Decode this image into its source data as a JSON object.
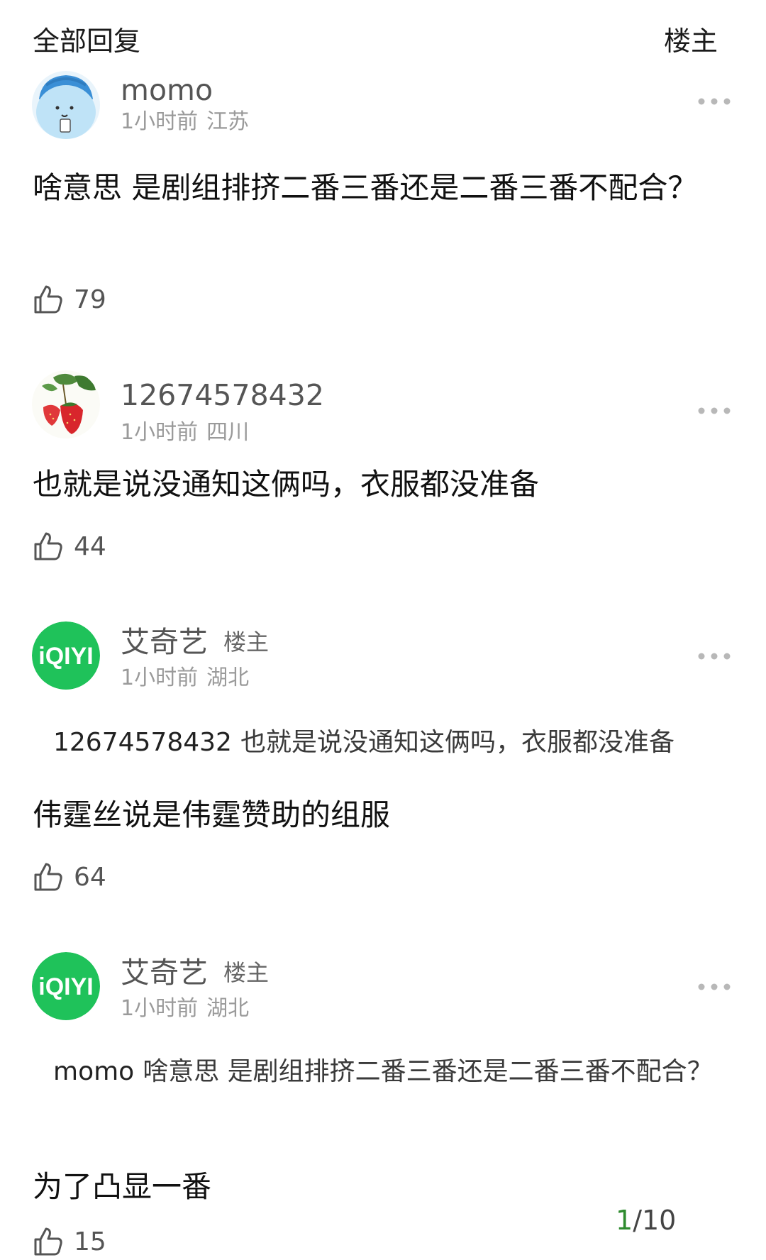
{
  "header": {
    "title": "全部回复",
    "filter": "楼主"
  },
  "comments": [
    {
      "username": "momo",
      "time": "1小时前",
      "location": "江苏",
      "text": "啥意思 是剧组排挤二番三番还是二番三番不配合？",
      "likes": "79",
      "avatar": "blue-cartoon-avatar"
    },
    {
      "username": "12674578432",
      "time": "1小时前",
      "location": "四川",
      "text": "也就是说没通知这俩吗，衣服都没准备",
      "likes": "44",
      "avatar": "strawberry-avatar"
    },
    {
      "username": "艾奇艺",
      "op_tag": "楼主",
      "time": "1小时前",
      "location": "湖北",
      "quote_user": "12674578432",
      "quote_text": "也就是说没通知这俩吗，衣服都没准备",
      "text": "伟霆丝说是伟霆赞助的组服",
      "likes": "64",
      "avatar": "iqiyi-logo-avatar"
    },
    {
      "username": "艾奇艺",
      "op_tag": "楼主",
      "time": "1小时前",
      "location": "湖北",
      "quote_user": "momo",
      "quote_text": "啥意思 是剧组排挤二番三番还是二番三番不配合？",
      "text": "为了凸显一番",
      "likes": "15",
      "avatar": "iqiyi-logo-avatar"
    }
  ],
  "pager": {
    "current": "1",
    "total": "/10"
  },
  "colors": {
    "iqiyi_green": "#1fc25a",
    "pager_current": "#2e8b2e"
  }
}
